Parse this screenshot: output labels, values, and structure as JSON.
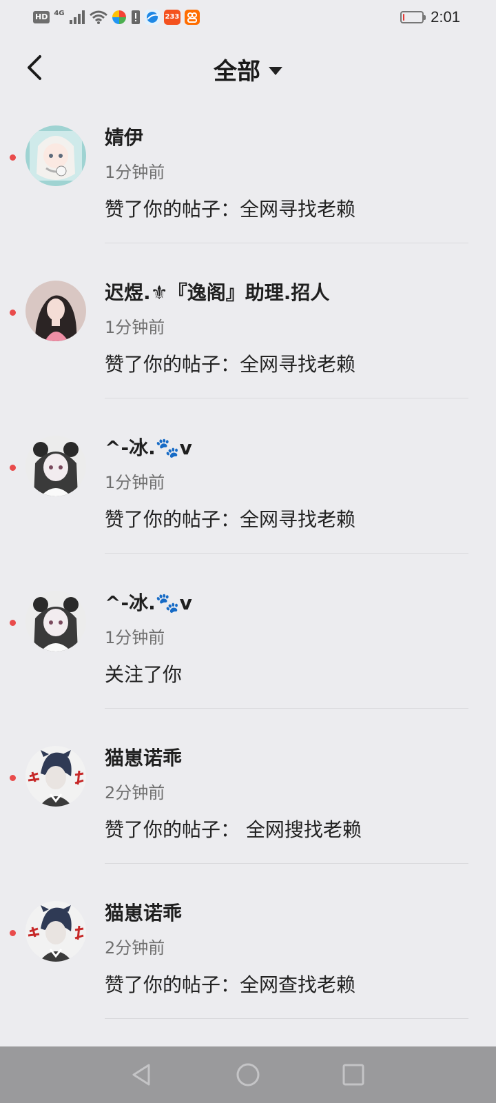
{
  "status_bar": {
    "hd_label": "HD",
    "network_label": "4G",
    "app_badge_label": "233",
    "time": "2:01",
    "battery_level": 0.08
  },
  "header": {
    "title": "全部",
    "back_icon": "back-chevron-icon",
    "dropdown_icon": "caret-down-icon"
  },
  "notifications": [
    {
      "name": "婧伊",
      "time": "1分钟前",
      "message": "赞了你的帖子：全网寻找老赖",
      "unread": true
    },
    {
      "name": "迟煜.⚜『逸阁』助理.招人",
      "time": "1分钟前",
      "message": "赞了你的帖子：全网寻找老赖",
      "unread": true
    },
    {
      "name": "^-冰.🐾v",
      "time": "1分钟前",
      "message": "赞了你的帖子：全网寻找老赖",
      "unread": true
    },
    {
      "name": "^-冰.🐾v",
      "time": "1分钟前",
      "message": "关注了你",
      "unread": true
    },
    {
      "name": "猫崽诺乖",
      "time": "2分钟前",
      "message": "赞了你的帖子： 全网搜找老赖",
      "unread": true
    },
    {
      "name": "猫崽诺乖",
      "time": "2分钟前",
      "message": "赞了你的帖子：全网查找老赖",
      "unread": true
    }
  ],
  "colors": {
    "background": "#ececef",
    "unread_dot": "#e94b4b",
    "nav_bar": "#9a9a9c"
  }
}
